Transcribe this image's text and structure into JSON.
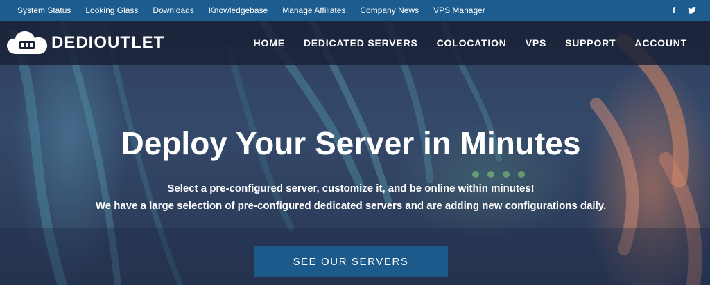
{
  "topbar": {
    "links": [
      "System Status",
      "Looking Glass",
      "Downloads",
      "Knowledgebase",
      "Manage Affiliates",
      "Company News",
      "VPS Manager"
    ],
    "social": {
      "facebook": "f"
    }
  },
  "brand": {
    "name": "DEDIOUTLET"
  },
  "nav": {
    "items": [
      "HOME",
      "DEDICATED SERVERS",
      "COLOCATION",
      "VPS",
      "SUPPORT",
      "ACCOUNT"
    ]
  },
  "hero": {
    "title": "Deploy Your Server in Minutes",
    "subtitle_line1": "Select a pre-configured server, customize it, and be online within minutes!",
    "subtitle_line2": "We have a large selection of pre-configured dedicated servers and are adding new configurations daily.",
    "cta": "SEE OUR SERVERS"
  },
  "colors": {
    "topbar": "#1c5c8e",
    "navbar": "#1a2238",
    "hero": "#2f3f60",
    "button": "#1b5a8a",
    "text": "#ffffff"
  },
  "icons": {
    "logo": "cloud-server-icon",
    "facebook": "facebook-icon",
    "twitter": "twitter-icon"
  }
}
